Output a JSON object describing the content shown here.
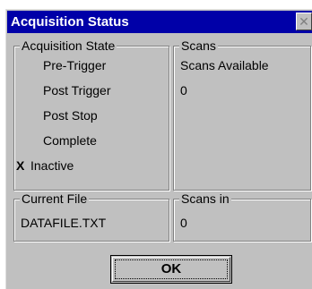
{
  "window": {
    "title": "Acquisition Status",
    "close_glyph": "✕"
  },
  "acquisition_state": {
    "legend": "Acquisition State",
    "items": [
      {
        "label": "Pre-Trigger",
        "checked": false
      },
      {
        "label": "Post Trigger",
        "checked": false
      },
      {
        "label": "Post Stop",
        "checked": false
      },
      {
        "label": "Complete",
        "checked": false
      },
      {
        "label": "Inactive",
        "checked": true
      }
    ],
    "check_mark": "X"
  },
  "scans": {
    "legend": "Scans",
    "label": "Scans Available",
    "value": "0"
  },
  "current_file": {
    "legend": "Current File",
    "value": "DATAFILE.TXT"
  },
  "scans_in": {
    "legend": "Scans in",
    "value": "0"
  },
  "ok_button": {
    "label": "OK"
  }
}
